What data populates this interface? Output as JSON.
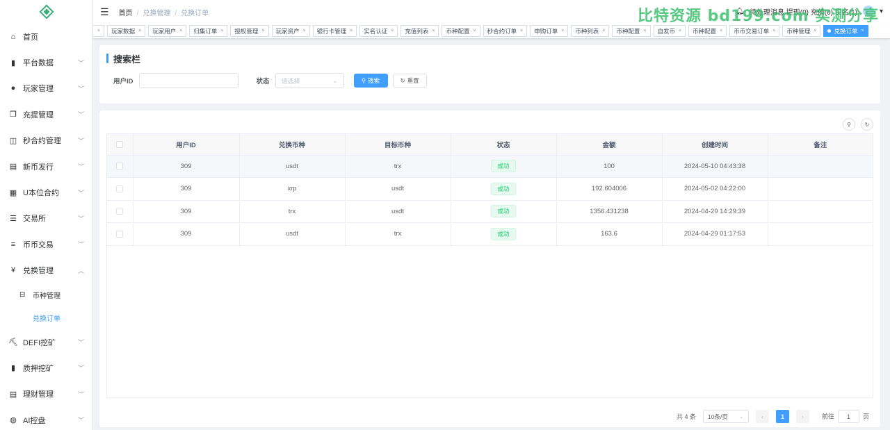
{
  "sidebar": {
    "items": [
      {
        "label": "首页",
        "icon": "dashboard-icon",
        "glyph": "⌂",
        "chevron": false
      },
      {
        "label": "平台数据",
        "icon": "book-icon",
        "glyph": "▮",
        "chevron": true
      },
      {
        "label": "玩家管理",
        "icon": "user-icon",
        "glyph": "●",
        "chevron": true
      },
      {
        "label": "充提管理",
        "icon": "copy-icon",
        "glyph": "❐",
        "chevron": true
      },
      {
        "label": "秒合约管理",
        "icon": "monitor-icon",
        "glyph": "◫",
        "chevron": true
      },
      {
        "label": "新币发行",
        "icon": "card-icon",
        "glyph": "▤",
        "chevron": true
      },
      {
        "label": "U本位合约",
        "icon": "grid-icon",
        "glyph": "▦",
        "chevron": true
      },
      {
        "label": "交易所",
        "icon": "list-icon",
        "glyph": "☰",
        "chevron": true
      },
      {
        "label": "币币交易",
        "icon": "list-icon",
        "glyph": "≡",
        "chevron": true
      },
      {
        "label": "兑换管理",
        "icon": "yen-icon",
        "glyph": "¥",
        "chevron": true,
        "open": true
      }
    ],
    "sub_items": [
      {
        "label": "币种管理",
        "icon": "coin-icon",
        "glyph": "⊟"
      },
      {
        "label": "兑换订单",
        "active": true
      }
    ],
    "items_after": [
      {
        "label": "DEFI挖矿",
        "icon": "runner-icon",
        "glyph": "⛏"
      },
      {
        "label": "质押挖矿",
        "icon": "bar-chart-icon",
        "glyph": "▮"
      },
      {
        "label": "理财管理",
        "icon": "file-icon",
        "glyph": "▤"
      },
      {
        "label": "AI控盘",
        "icon": "robot-icon",
        "glyph": "◍"
      }
    ]
  },
  "header": {
    "breadcrumb": [
      "首页",
      "兑换管理",
      "兑换订单"
    ],
    "right_text": "待处理消息 提现(0) 充值(0) 实名(1)",
    "watermark": "比特资源 bd199.com 实测分享"
  },
  "tags": [
    {
      "label": "玩家数据"
    },
    {
      "label": "玩家用户"
    },
    {
      "label": "归集订单"
    },
    {
      "label": "授权管理"
    },
    {
      "label": "玩家资产"
    },
    {
      "label": "银行卡管理"
    },
    {
      "label": "实名认证"
    },
    {
      "label": "充值列表"
    },
    {
      "label": "币种配置"
    },
    {
      "label": "秒合约订单"
    },
    {
      "label": "申购订单"
    },
    {
      "label": "币种列表"
    },
    {
      "label": "币种配置"
    },
    {
      "label": "自发币"
    },
    {
      "label": "币种配置"
    },
    {
      "label": "币币交易订单"
    },
    {
      "label": "币种管理"
    },
    {
      "label": "兑换订单",
      "active": true
    }
  ],
  "search": {
    "title": "搜索栏",
    "user_id_label": "用户ID",
    "user_id_value": "",
    "status_label": "状态",
    "status_placeholder": "请选择",
    "search_button": "搜索",
    "reset_button": "重置"
  },
  "table": {
    "columns": [
      "用户ID",
      "兑换币种",
      "目标币种",
      "状态",
      "金额",
      "创建时间",
      "备注"
    ],
    "rows": [
      {
        "user_id": "309",
        "from": "usdt",
        "to": "trx",
        "status": "成功",
        "amount": "100",
        "created": "2024-05-10 04:43:38",
        "note": ""
      },
      {
        "user_id": "309",
        "from": "xrp",
        "to": "usdt",
        "status": "成功",
        "amount": "192.604006",
        "created": "2024-05-02 04:22:00",
        "note": ""
      },
      {
        "user_id": "309",
        "from": "trx",
        "to": "usdt",
        "status": "成功",
        "amount": "1356.431238",
        "created": "2024-04-29 14:29:39",
        "note": ""
      },
      {
        "user_id": "309",
        "from": "usdt",
        "to": "trx",
        "status": "成功",
        "amount": "163.6",
        "created": "2024-04-29 01:17:53",
        "note": ""
      }
    ]
  },
  "pagination": {
    "total": "共 4 条",
    "page_size": "10条/页",
    "current": "1",
    "goto_label": "前往",
    "goto_value": "1",
    "page_suffix": "页"
  },
  "colors": {
    "primary": "#409eff",
    "success": "#13ce66"
  }
}
